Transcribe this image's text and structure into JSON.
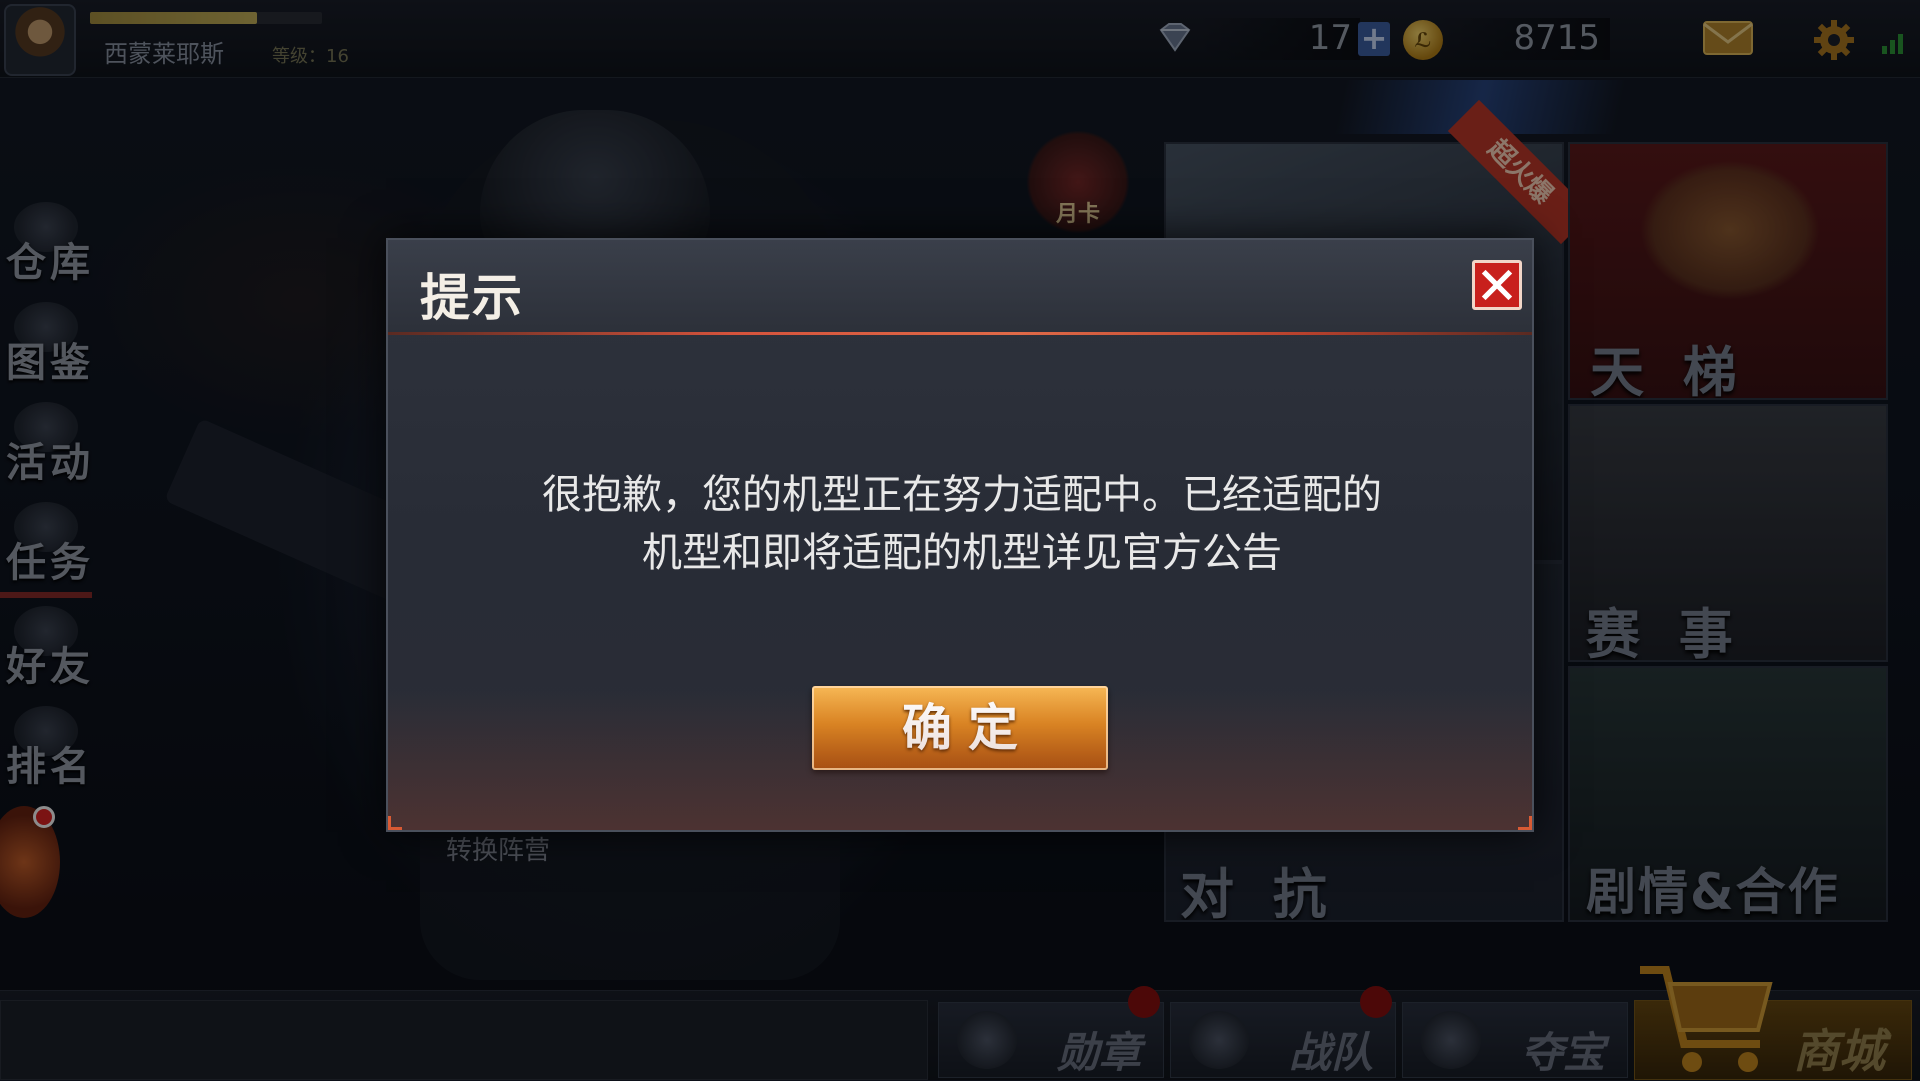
{
  "player": {
    "name": "西蒙莱耶斯",
    "level_text": "等级：16",
    "xp_fraction": 0.72
  },
  "currency": {
    "gems": "17",
    "gold": "8715"
  },
  "sidebar": {
    "items": [
      {
        "label": "仓库",
        "icon": "warehouse-icon"
      },
      {
        "label": "图鉴",
        "icon": "codex-icon"
      },
      {
        "label": "活动",
        "icon": "event-icon"
      },
      {
        "label": "任务",
        "icon": "mission-icon"
      },
      {
        "label": "好友",
        "icon": "friends-icon"
      },
      {
        "label": "排名",
        "icon": "ranking-icon"
      }
    ]
  },
  "scene": {
    "month_card": "月卡",
    "switch_faction": "转换阵营",
    "hot_badge": "超火爆"
  },
  "modes": {
    "versus": "对 抗",
    "ladder": "天 梯",
    "match": "赛 事",
    "story": "剧情&合作"
  },
  "bottom_nav": {
    "medal": "勋章",
    "team": "战队",
    "treasure": "夺宝",
    "shop": "商城"
  },
  "dialog": {
    "title": "提示",
    "message_line1": "很抱歉，您的机型正在努力适配中。已经适配的",
    "message_line2": "机型和即将适配的机型详见官方公告",
    "confirm_label": "确定"
  },
  "colors": {
    "accent_red": "#d5533c",
    "confirm_orange": "#e08a23",
    "close_red": "#c8201c"
  }
}
